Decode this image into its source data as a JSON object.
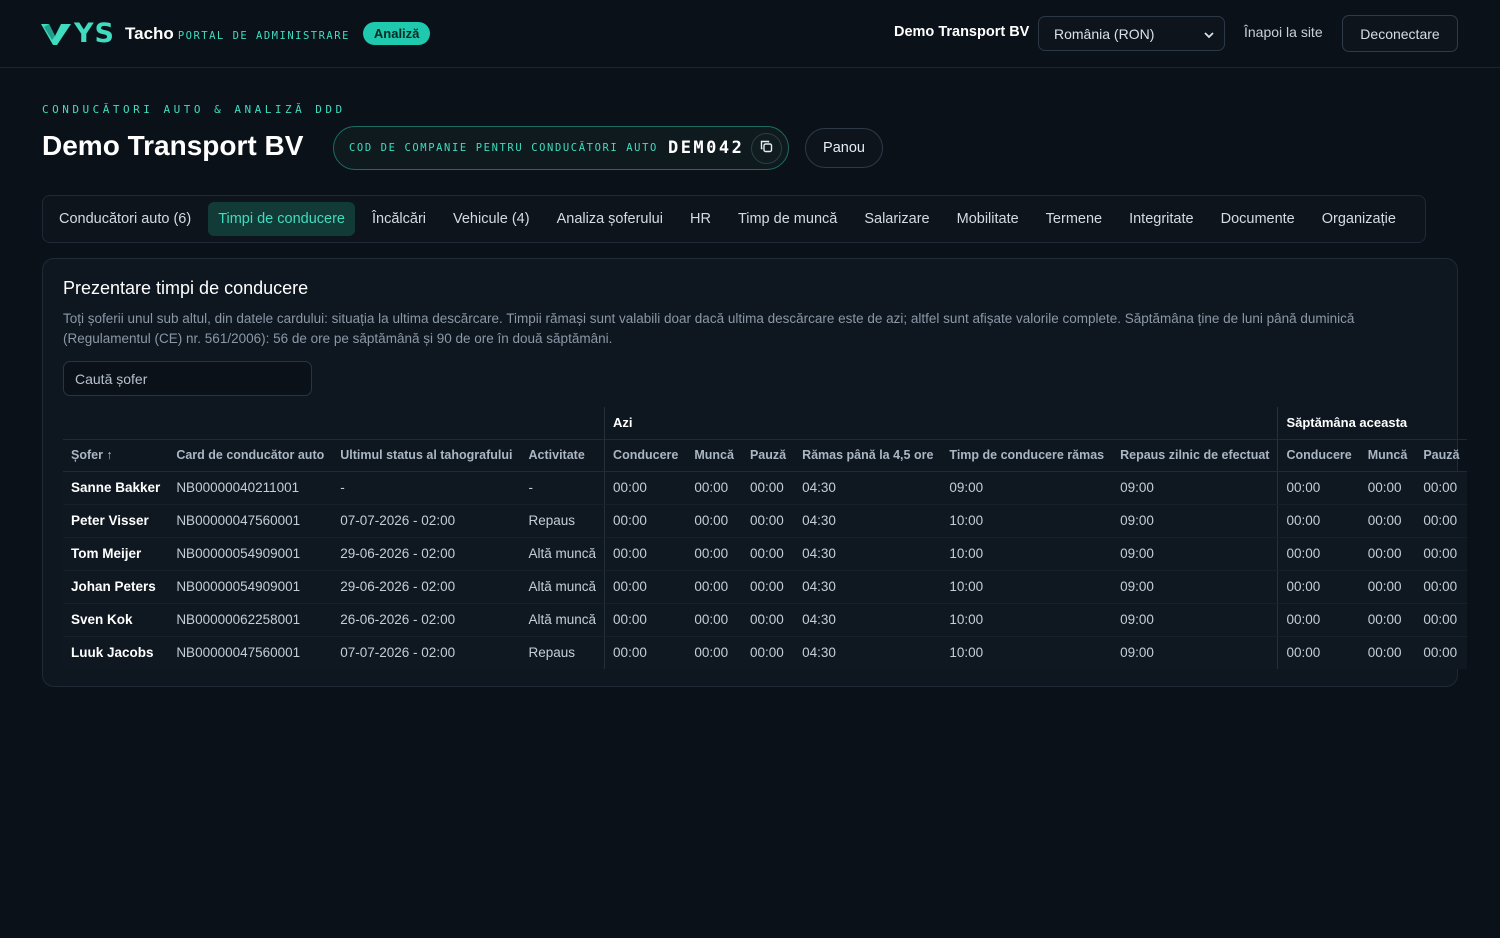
{
  "header": {
    "logo_text": "YS",
    "brand": "Tacho",
    "portal": "PORTAL DE ADMINISTRARE",
    "badge": "Analiză",
    "company": "Demo Transport BV",
    "country": "România (RON)",
    "back_link": "Înapoi la site",
    "logout": "Deconectare"
  },
  "page": {
    "eyebrow": "CONDUCĂTORI AUTO & ANALIZĂ DDD",
    "title": "Demo Transport BV",
    "code_label": "COD DE COMPANIE PENTRU CONDUCĂTORI AUTO",
    "code_value": "DEM042",
    "panou": "Panou"
  },
  "tabs": [
    {
      "label": "Conducători auto (6)"
    },
    {
      "label": "Timpi de conducere"
    },
    {
      "label": "Încălcări"
    },
    {
      "label": "Vehicule (4)"
    },
    {
      "label": "Analiza șoferului"
    },
    {
      "label": "HR"
    },
    {
      "label": "Timp de muncă"
    },
    {
      "label": "Salarizare"
    },
    {
      "label": "Mobilitate"
    },
    {
      "label": "Termene"
    },
    {
      "label": "Integritate"
    },
    {
      "label": "Documente"
    },
    {
      "label": "Organizație"
    }
  ],
  "overview": {
    "title": "Prezentare timpi de conducere",
    "description": "Toți șoferii unul sub altul, din datele cardului: situația la ultima descărcare. Timpii rămași sunt valabili doar dacă ultima descărcare este de azi; altfel sunt afișate valorile complete. Săptămâna ține de luni până duminică (Regulamentul (CE) nr. 561/2006): 56 de ore pe săptămână și 90 de ore în două săptămâni.",
    "search_placeholder": "Caută șofer"
  },
  "table": {
    "groups": {
      "today": "Azi",
      "week": "Săptămâna aceasta"
    },
    "columns": [
      "Șofer ↑",
      "Card de conducător auto",
      "Ultimul status al tahografului",
      "Activitate",
      "Conducere",
      "Muncă",
      "Pauză",
      "Rămas până la 4,5 ore",
      "Timp de conducere rămas",
      "Repaus zilnic de efectuat",
      "Conducere",
      "Muncă",
      "Pauză"
    ],
    "rows": [
      [
        "Sanne Bakker",
        "NB00000040211001",
        "-",
        "-",
        "00:00",
        "00:00",
        "00:00",
        "04:30",
        "09:00",
        "09:00",
        "00:00",
        "00:00",
        "00:00"
      ],
      [
        "Peter Visser",
        "NB00000047560001",
        "07-07-2026 - 02:00",
        "Repaus",
        "00:00",
        "00:00",
        "00:00",
        "04:30",
        "10:00",
        "09:00",
        "00:00",
        "00:00",
        "00:00"
      ],
      [
        "Tom Meijer",
        "NB00000054909001",
        "29-06-2026 - 02:00",
        "Altă muncă",
        "00:00",
        "00:00",
        "00:00",
        "04:30",
        "10:00",
        "09:00",
        "00:00",
        "00:00",
        "00:00"
      ],
      [
        "Johan Peters",
        "NB00000054909001",
        "29-06-2026 - 02:00",
        "Altă muncă",
        "00:00",
        "00:00",
        "00:00",
        "04:30",
        "10:00",
        "09:00",
        "00:00",
        "00:00",
        "00:00"
      ],
      [
        "Sven Kok",
        "NB00000062258001",
        "26-06-2026 - 02:00",
        "Altă muncă",
        "00:00",
        "00:00",
        "00:00",
        "04:30",
        "10:00",
        "09:00",
        "00:00",
        "00:00",
        "00:00"
      ],
      [
        "Luuk Jacobs",
        "NB00000047560001",
        "07-07-2026 - 02:00",
        "Repaus",
        "00:00",
        "00:00",
        "00:00",
        "04:30",
        "10:00",
        "09:00",
        "00:00",
        "00:00",
        "00:00"
      ]
    ]
  },
  "colors": {
    "accent": "#3fdcc0",
    "background": "#0b1119",
    "card": "#0e161f"
  }
}
